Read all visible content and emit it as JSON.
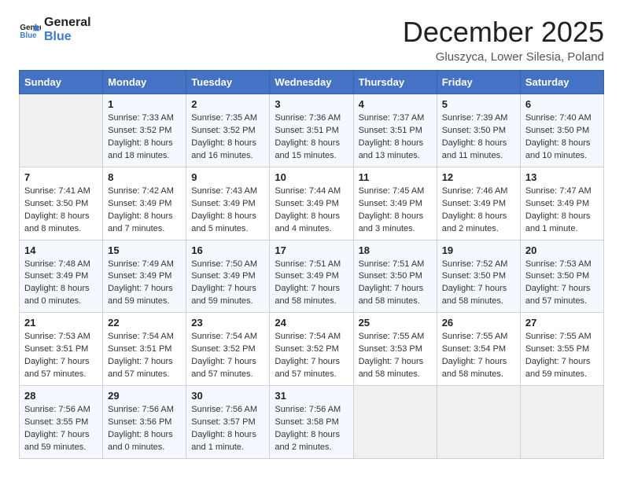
{
  "logo": {
    "line1": "General",
    "line2": "Blue"
  },
  "title": "December 2025",
  "location": "Gluszyca, Lower Silesia, Poland",
  "days_of_week": [
    "Sunday",
    "Monday",
    "Tuesday",
    "Wednesday",
    "Thursday",
    "Friday",
    "Saturday"
  ],
  "weeks": [
    [
      {
        "day": "",
        "info": ""
      },
      {
        "day": "1",
        "info": "Sunrise: 7:33 AM\nSunset: 3:52 PM\nDaylight: 8 hours\nand 18 minutes."
      },
      {
        "day": "2",
        "info": "Sunrise: 7:35 AM\nSunset: 3:52 PM\nDaylight: 8 hours\nand 16 minutes."
      },
      {
        "day": "3",
        "info": "Sunrise: 7:36 AM\nSunset: 3:51 PM\nDaylight: 8 hours\nand 15 minutes."
      },
      {
        "day": "4",
        "info": "Sunrise: 7:37 AM\nSunset: 3:51 PM\nDaylight: 8 hours\nand 13 minutes."
      },
      {
        "day": "5",
        "info": "Sunrise: 7:39 AM\nSunset: 3:50 PM\nDaylight: 8 hours\nand 11 minutes."
      },
      {
        "day": "6",
        "info": "Sunrise: 7:40 AM\nSunset: 3:50 PM\nDaylight: 8 hours\nand 10 minutes."
      }
    ],
    [
      {
        "day": "7",
        "info": "Sunrise: 7:41 AM\nSunset: 3:50 PM\nDaylight: 8 hours\nand 8 minutes."
      },
      {
        "day": "8",
        "info": "Sunrise: 7:42 AM\nSunset: 3:49 PM\nDaylight: 8 hours\nand 7 minutes."
      },
      {
        "day": "9",
        "info": "Sunrise: 7:43 AM\nSunset: 3:49 PM\nDaylight: 8 hours\nand 5 minutes."
      },
      {
        "day": "10",
        "info": "Sunrise: 7:44 AM\nSunset: 3:49 PM\nDaylight: 8 hours\nand 4 minutes."
      },
      {
        "day": "11",
        "info": "Sunrise: 7:45 AM\nSunset: 3:49 PM\nDaylight: 8 hours\nand 3 minutes."
      },
      {
        "day": "12",
        "info": "Sunrise: 7:46 AM\nSunset: 3:49 PM\nDaylight: 8 hours\nand 2 minutes."
      },
      {
        "day": "13",
        "info": "Sunrise: 7:47 AM\nSunset: 3:49 PM\nDaylight: 8 hours\nand 1 minute."
      }
    ],
    [
      {
        "day": "14",
        "info": "Sunrise: 7:48 AM\nSunset: 3:49 PM\nDaylight: 8 hours\nand 0 minutes."
      },
      {
        "day": "15",
        "info": "Sunrise: 7:49 AM\nSunset: 3:49 PM\nDaylight: 7 hours\nand 59 minutes."
      },
      {
        "day": "16",
        "info": "Sunrise: 7:50 AM\nSunset: 3:49 PM\nDaylight: 7 hours\nand 59 minutes."
      },
      {
        "day": "17",
        "info": "Sunrise: 7:51 AM\nSunset: 3:49 PM\nDaylight: 7 hours\nand 58 minutes."
      },
      {
        "day": "18",
        "info": "Sunrise: 7:51 AM\nSunset: 3:50 PM\nDaylight: 7 hours\nand 58 minutes."
      },
      {
        "day": "19",
        "info": "Sunrise: 7:52 AM\nSunset: 3:50 PM\nDaylight: 7 hours\nand 58 minutes."
      },
      {
        "day": "20",
        "info": "Sunrise: 7:53 AM\nSunset: 3:50 PM\nDaylight: 7 hours\nand 57 minutes."
      }
    ],
    [
      {
        "day": "21",
        "info": "Sunrise: 7:53 AM\nSunset: 3:51 PM\nDaylight: 7 hours\nand 57 minutes."
      },
      {
        "day": "22",
        "info": "Sunrise: 7:54 AM\nSunset: 3:51 PM\nDaylight: 7 hours\nand 57 minutes."
      },
      {
        "day": "23",
        "info": "Sunrise: 7:54 AM\nSunset: 3:52 PM\nDaylight: 7 hours\nand 57 minutes."
      },
      {
        "day": "24",
        "info": "Sunrise: 7:54 AM\nSunset: 3:52 PM\nDaylight: 7 hours\nand 57 minutes."
      },
      {
        "day": "25",
        "info": "Sunrise: 7:55 AM\nSunset: 3:53 PM\nDaylight: 7 hours\nand 58 minutes."
      },
      {
        "day": "26",
        "info": "Sunrise: 7:55 AM\nSunset: 3:54 PM\nDaylight: 7 hours\nand 58 minutes."
      },
      {
        "day": "27",
        "info": "Sunrise: 7:55 AM\nSunset: 3:55 PM\nDaylight: 7 hours\nand 59 minutes."
      }
    ],
    [
      {
        "day": "28",
        "info": "Sunrise: 7:56 AM\nSunset: 3:55 PM\nDaylight: 7 hours\nand 59 minutes."
      },
      {
        "day": "29",
        "info": "Sunrise: 7:56 AM\nSunset: 3:56 PM\nDaylight: 8 hours\nand 0 minutes."
      },
      {
        "day": "30",
        "info": "Sunrise: 7:56 AM\nSunset: 3:57 PM\nDaylight: 8 hours\nand 1 minute."
      },
      {
        "day": "31",
        "info": "Sunrise: 7:56 AM\nSunset: 3:58 PM\nDaylight: 8 hours\nand 2 minutes."
      },
      {
        "day": "",
        "info": ""
      },
      {
        "day": "",
        "info": ""
      },
      {
        "day": "",
        "info": ""
      }
    ]
  ]
}
